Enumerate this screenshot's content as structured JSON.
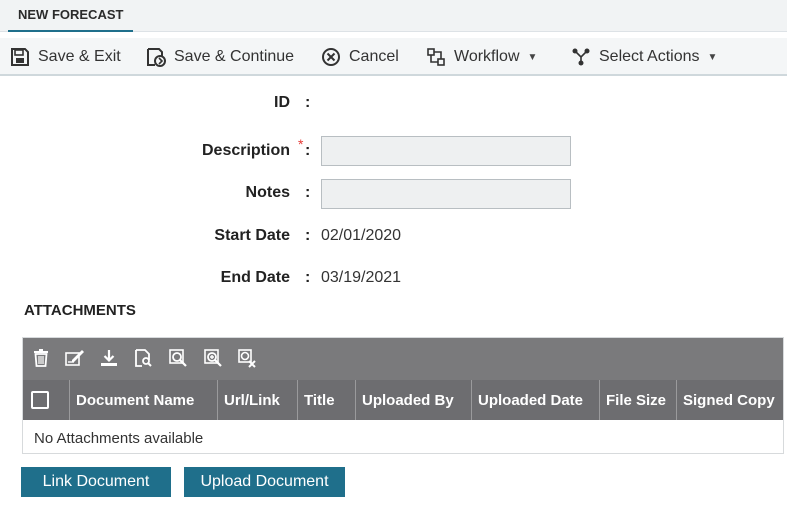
{
  "tab": {
    "label": "NEW FORECAST"
  },
  "toolbar": {
    "save_exit": "Save & Exit",
    "save_continue": "Save & Continue",
    "cancel": "Cancel",
    "workflow": "Workflow",
    "select_actions": "Select Actions"
  },
  "form": {
    "id_label": "ID",
    "description_label": "Description",
    "description_required": "*",
    "notes_label": "Notes",
    "start_date_label": "Start Date",
    "start_date_value": "02/01/2020",
    "end_date_label": "End Date",
    "end_date_value": "03/19/2021",
    "colon": ":"
  },
  "attachments": {
    "title": "ATTACHMENTS",
    "columns": [
      "Document Name",
      "Url/Link",
      "Title",
      "Uploaded By",
      "Uploaded Date",
      "File Size",
      "Signed Copy"
    ],
    "empty_text": "No Attachments available",
    "tools": [
      "delete-icon",
      "edit-icon",
      "download-icon",
      "view-icon",
      "search-icon",
      "zoom-in-icon",
      "clear-icon"
    ]
  },
  "buttons": {
    "link_document": "Link Document",
    "upload_document": "Upload Document"
  },
  "colors": {
    "accent": "#1f6f8b",
    "grid_toolbar": "#7a7a7c",
    "grid_header": "#6d6d70",
    "required": "#e53935"
  }
}
